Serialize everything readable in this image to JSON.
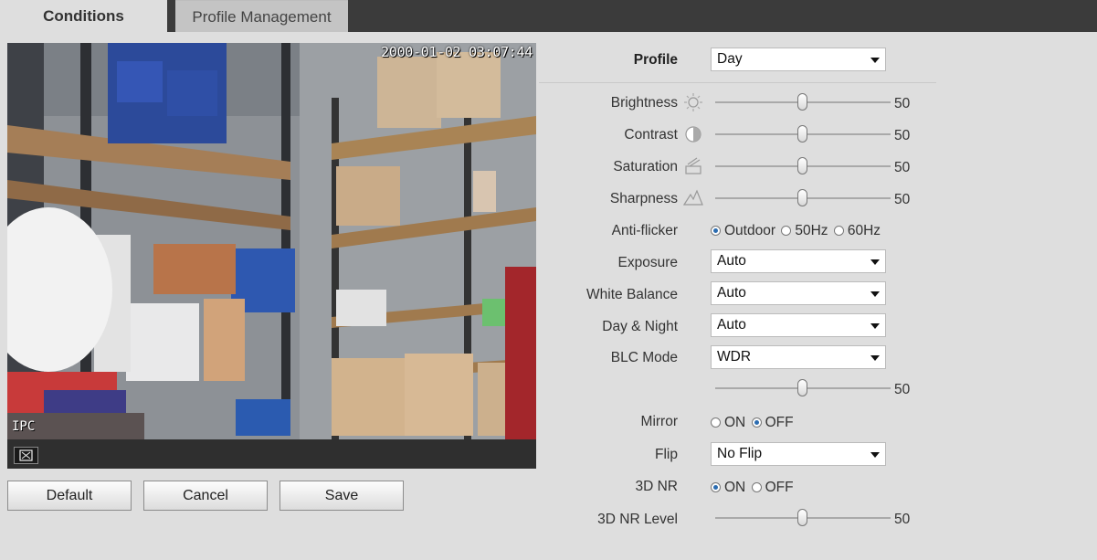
{
  "tabs": {
    "active": "Conditions",
    "inactive": "Profile Management"
  },
  "video": {
    "timestamp": "2000-01-02 03:07:44",
    "channel_label": "IPC"
  },
  "buttons": {
    "default": "Default",
    "cancel": "Cancel",
    "save": "Save"
  },
  "settings": {
    "profile": {
      "label": "Profile",
      "value": "Day"
    },
    "brightness": {
      "label": "Brightness",
      "value": 50,
      "icon": "sun-icon"
    },
    "contrast": {
      "label": "Contrast",
      "value": 50,
      "icon": "contrast-icon"
    },
    "saturation": {
      "label": "Saturation",
      "value": 50,
      "icon": "saturation-icon"
    },
    "sharpness": {
      "label": "Sharpness",
      "value": 50,
      "icon": "sharpness-icon"
    },
    "anti_flicker": {
      "label": "Anti-flicker",
      "options": [
        "Outdoor",
        "50Hz",
        "60Hz"
      ],
      "selected": "Outdoor"
    },
    "exposure": {
      "label": "Exposure",
      "value": "Auto"
    },
    "white_balance": {
      "label": "White Balance",
      "value": "Auto"
    },
    "day_night": {
      "label": "Day & Night",
      "value": "Auto"
    },
    "blc_mode": {
      "label": "BLC Mode",
      "value": "WDR"
    },
    "wdr_level": {
      "value": 50
    },
    "mirror": {
      "label": "Mirror",
      "options": [
        "ON",
        "OFF"
      ],
      "selected": "OFF"
    },
    "flip": {
      "label": "Flip",
      "value": "No Flip"
    },
    "nr3d": {
      "label": "3D NR",
      "options": [
        "ON",
        "OFF"
      ],
      "selected": "ON"
    },
    "nr3d_level": {
      "label": "3D NR Level",
      "value": 50
    }
  },
  "colors": {
    "top_bar": "#3b3b3b",
    "background": "#dedede",
    "radio_selected": "#2b6cb0"
  }
}
